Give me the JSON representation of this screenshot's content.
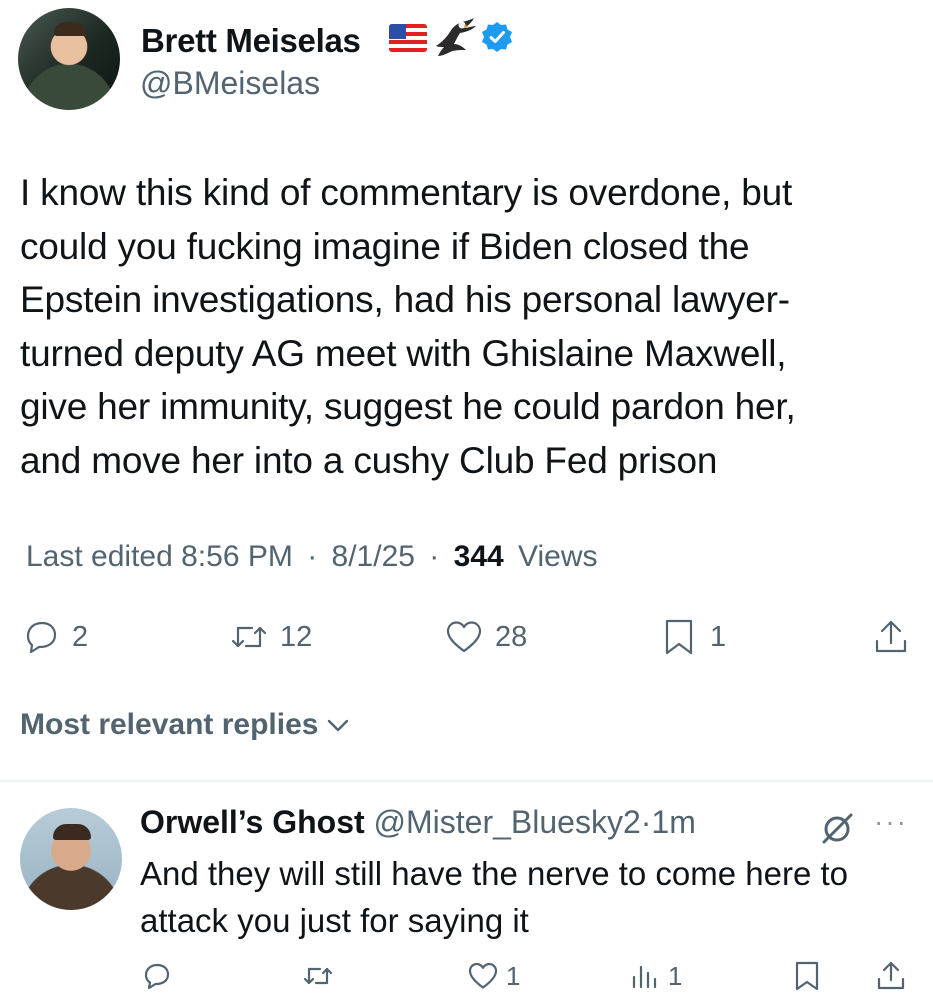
{
  "author": {
    "name": "Brett Meiselas",
    "handle": "@BMeiselas",
    "emoji": [
      "us-flag",
      "eagle"
    ],
    "verified": true,
    "verified_color": "#1d9bf0"
  },
  "tweet": {
    "lines": [
      "I know this kind of commentary is overdone, but",
      "could you fucking imagine if Biden closed the",
      "Epstein investigations, had his personal lawyer-",
      "turned deputy AG meet with Ghislaine Maxwell,",
      "give her immunity, suggest he could pardon her,",
      "and move her into a cushy Club Fed prison"
    ]
  },
  "meta": {
    "edited_label": "Last edited 8:56 PM",
    "separator": "·",
    "date": "8/1/25",
    "views_count": "344",
    "views_label": "Views"
  },
  "actions": {
    "replies": "2",
    "reposts": "12",
    "likes": "28",
    "bookmarks": "1"
  },
  "replies_sort": {
    "label": "Most relevant replies"
  },
  "reply": {
    "name": "Orwell’s Ghost",
    "handle": "@Mister_Bluesky2",
    "separator": "·",
    "time": "1m",
    "lines": [
      "And they will still have the nerve to come here to",
      "attack you just for saying it"
    ],
    "likes": "1",
    "views": "1",
    "more_label": "···"
  },
  "colors": {
    "text": "#0f1419",
    "muted": "#536471",
    "divider": "#eff3f4",
    "accent": "#1d9bf0"
  }
}
